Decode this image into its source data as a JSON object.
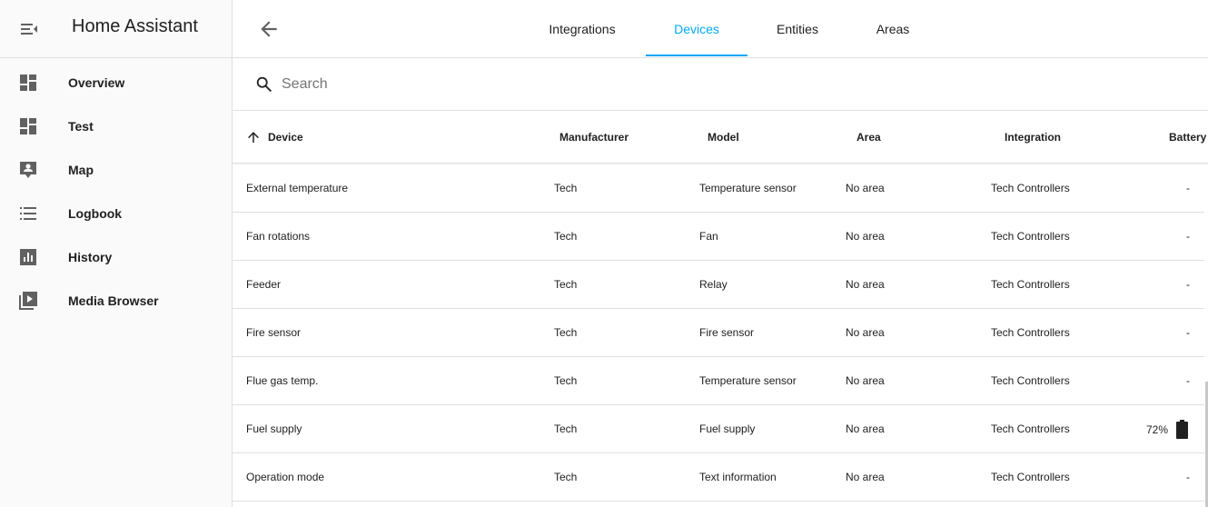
{
  "app": {
    "title": "Home Assistant"
  },
  "sidebar": {
    "items": [
      {
        "label": "Overview",
        "icon": "dashboard-icon"
      },
      {
        "label": "Test",
        "icon": "dashboard-icon"
      },
      {
        "label": "Map",
        "icon": "map-account-icon"
      },
      {
        "label": "Logbook",
        "icon": "list-icon"
      },
      {
        "label": "History",
        "icon": "chart-box-icon"
      },
      {
        "label": "Media Browser",
        "icon": "media-play-icon"
      }
    ]
  },
  "tabs": [
    {
      "label": "Integrations",
      "active": false
    },
    {
      "label": "Devices",
      "active": true
    },
    {
      "label": "Entities",
      "active": false
    },
    {
      "label": "Areas",
      "active": false
    }
  ],
  "search": {
    "placeholder": "Search",
    "value": ""
  },
  "table": {
    "columns": {
      "device": "Device",
      "manufacturer": "Manufacturer",
      "model": "Model",
      "area": "Area",
      "integration": "Integration",
      "battery": "Battery"
    },
    "rows": [
      {
        "device": "External temperature",
        "manufacturer": "Tech",
        "model": "Temperature sensor",
        "area": "No area",
        "integration": "Tech Controllers",
        "battery": "-"
      },
      {
        "device": "Fan rotations",
        "manufacturer": "Tech",
        "model": "Fan",
        "area": "No area",
        "integration": "Tech Controllers",
        "battery": "-"
      },
      {
        "device": "Feeder",
        "manufacturer": "Tech",
        "model": "Relay",
        "area": "No area",
        "integration": "Tech Controllers",
        "battery": "-"
      },
      {
        "device": "Fire sensor",
        "manufacturer": "Tech",
        "model": "Fire sensor",
        "area": "No area",
        "integration": "Tech Controllers",
        "battery": "-"
      },
      {
        "device": "Flue gas temp.",
        "manufacturer": "Tech",
        "model": "Temperature sensor",
        "area": "No area",
        "integration": "Tech Controllers",
        "battery": "-"
      },
      {
        "device": "Fuel supply",
        "manufacturer": "Tech",
        "model": "Fuel supply",
        "area": "No area",
        "integration": "Tech Controllers",
        "battery": "72%",
        "battery_icon": "battery-icon"
      },
      {
        "device": "Operation mode",
        "manufacturer": "Tech",
        "model": "Text information",
        "area": "No area",
        "integration": "Tech Controllers",
        "battery": "-"
      }
    ]
  },
  "colors": {
    "accent": "#03a9f4",
    "icon": "#616161",
    "text": "#212121",
    "divider": "#e0e0e0"
  }
}
